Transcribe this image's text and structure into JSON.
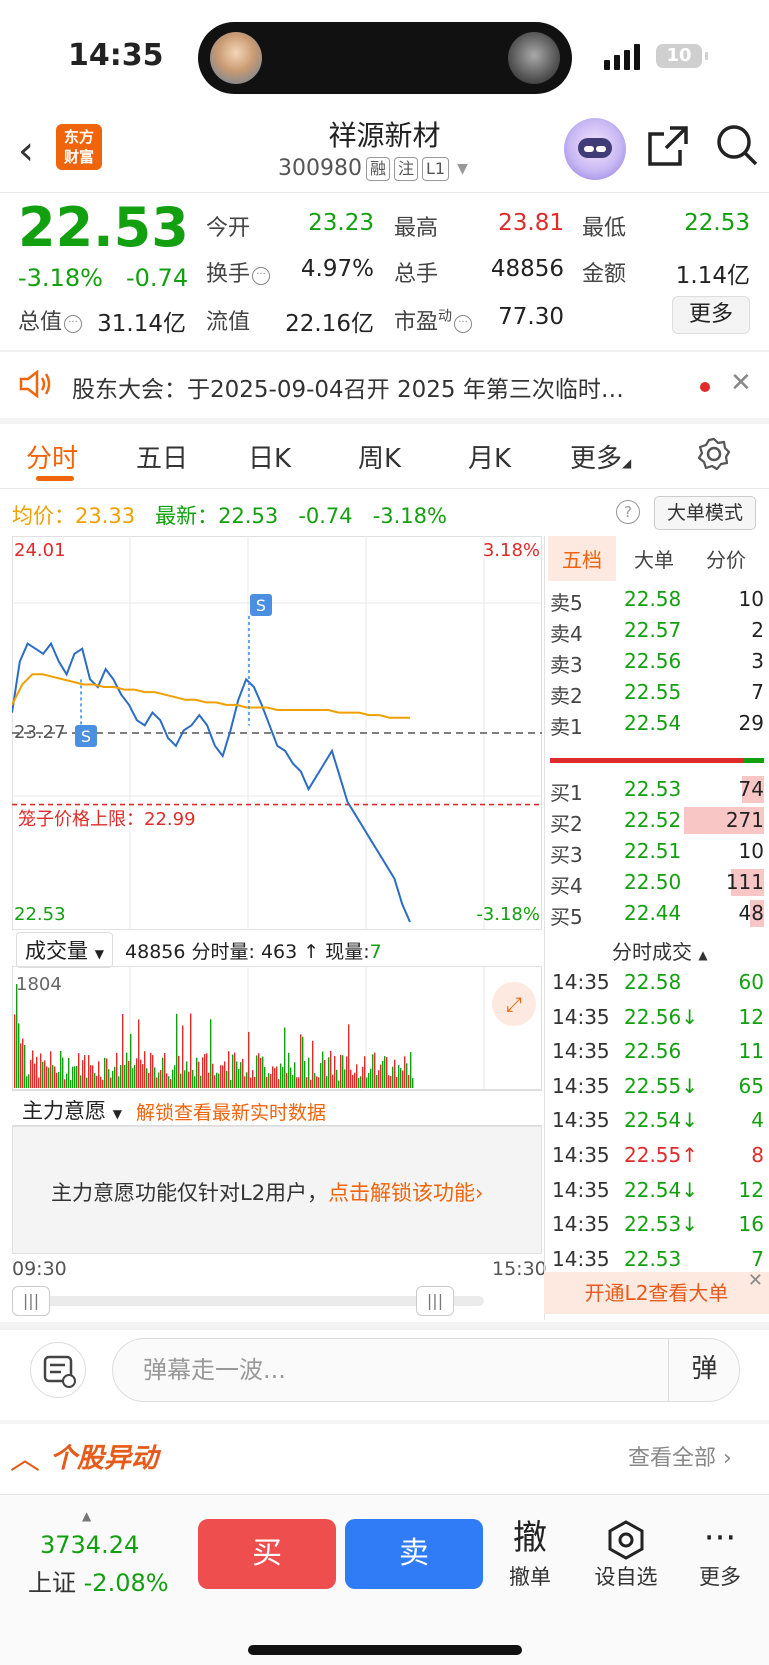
{
  "status": {
    "time": "14:35",
    "battery": "10"
  },
  "header": {
    "logo": "东方\n财富",
    "title": "祥源新材",
    "code": "300980",
    "tags": [
      "融",
      "注",
      "L1"
    ]
  },
  "quote": {
    "price": "22.53",
    "change_pct": "-3.18%",
    "change": "-0.74",
    "fields": {
      "open_label": "今开",
      "open": "23.23",
      "high_label": "最高",
      "high": "23.81",
      "low_label": "最低",
      "low": "22.53",
      "turnover_label": "换手",
      "turnover": "4.97%",
      "vol_label": "总手",
      "vol": "48856",
      "amount_label": "金额",
      "amount": "1.14亿",
      "mktcap_label": "总值",
      "mktcap": "31.14亿",
      "float_label": "流值",
      "float": "22.16亿",
      "pe_label": "市盈",
      "pe_sup": "动",
      "pe": "77.30"
    },
    "more": "更多"
  },
  "notice": {
    "text": "股东大会：于2025-09-04召开 2025 年第三次临时…"
  },
  "tabs": [
    "分时",
    "五日",
    "日K",
    "周K",
    "月K",
    "更多"
  ],
  "chart_head": {
    "avg_label": "均价：",
    "avg": "23.33",
    "latest_label": "最新：",
    "latest": "22.53",
    "latest_chg": "-0.74",
    "latest_pct": "-3.18%",
    "mode_btn": "大单模式",
    "help": "?"
  },
  "chart_labels": {
    "top_price": "24.01",
    "top_pct": "3.18%",
    "mid_price": "23.27",
    "cage_label": "笼子价格上限：22.99",
    "bottom_price": "22.53",
    "bottom_pct": "-3.18%",
    "marker": "S",
    "time_start": "09:30",
    "time_end": "15:30"
  },
  "chart_data": {
    "type": "line",
    "x_range": [
      "09:30",
      "15:00"
    ],
    "ylim": [
      22.53,
      24.01
    ],
    "prev_close": 23.27,
    "cage_upper": 22.99,
    "series": [
      {
        "values": [
          23.35,
          23.55,
          23.62,
          23.6,
          23.58,
          23.62,
          23.55,
          23.5,
          23.58,
          23.6,
          23.48,
          23.45,
          23.52,
          23.48,
          23.42,
          23.38,
          23.32,
          23.3,
          23.35,
          23.32,
          23.25,
          23.22,
          23.28,
          23.3,
          23.34,
          23.3,
          23.22,
          23.18,
          23.28,
          23.4,
          23.48,
          23.45,
          23.38,
          23.3,
          23.22,
          23.2,
          23.15,
          23.12,
          23.05,
          23.1,
          23.15,
          23.2,
          23.1,
          23.0,
          22.95,
          22.9,
          22.85,
          22.8,
          22.75,
          22.7,
          22.6,
          22.53
        ]
      },
      {
        "values": [
          23.38,
          23.46,
          23.5,
          23.5,
          23.49,
          23.48,
          23.47,
          23.46,
          23.46,
          23.45,
          23.45,
          23.44,
          23.44,
          23.43,
          23.43,
          23.42,
          23.41,
          23.4,
          23.4,
          23.39,
          23.39,
          23.38,
          23.38,
          23.37,
          23.37,
          23.37,
          23.36,
          23.36,
          23.36,
          23.36,
          23.36,
          23.36,
          23.35,
          23.35,
          23.35,
          23.34,
          23.34,
          23.33,
          23.33,
          23.33
        ]
      }
    ],
    "volume_max": "1804"
  },
  "vol_head": {
    "dropdown": "成交量",
    "vol": "48856",
    "fs_label": "分时量:",
    "fs": "463",
    "arrow": "↑",
    "cur_label": "现量:",
    "cur": "7"
  },
  "mainforce": {
    "dropdown": "主力意愿",
    "unlock": "解锁查看最新实时数据",
    "text": "主力意愿功能仅针对L2用户，",
    "link": "点击解锁该功能›"
  },
  "orderbook": {
    "tabs": [
      "五档",
      "大单",
      "分价"
    ],
    "asks": [
      {
        "label": "卖5",
        "price": "22.58",
        "vol": "10"
      },
      {
        "label": "卖4",
        "price": "22.57",
        "vol": "2"
      },
      {
        "label": "卖3",
        "price": "22.56",
        "vol": "3"
      },
      {
        "label": "卖2",
        "price": "22.55",
        "vol": "7"
      },
      {
        "label": "卖1",
        "price": "22.54",
        "vol": "29"
      }
    ],
    "bids": [
      {
        "label": "买1",
        "price": "22.53",
        "vol": "74"
      },
      {
        "label": "买2",
        "price": "22.52",
        "vol": "271"
      },
      {
        "label": "买3",
        "price": "22.51",
        "vol": "10"
      },
      {
        "label": "买4",
        "price": "22.50",
        "vol": "111"
      },
      {
        "label": "买5",
        "price": "22.44",
        "vol": "48"
      }
    ]
  },
  "deals": {
    "title": "分时成交",
    "rows": [
      {
        "t": "14:35",
        "p": "22.58",
        "v": "60",
        "c": "green"
      },
      {
        "t": "14:35",
        "p": "22.56↓",
        "v": "12",
        "c": "green"
      },
      {
        "t": "14:35",
        "p": "22.56",
        "v": "11",
        "c": "green"
      },
      {
        "t": "14:35",
        "p": "22.55↓",
        "v": "65",
        "c": "green"
      },
      {
        "t": "14:35",
        "p": "22.54↓",
        "v": "4",
        "c": "green"
      },
      {
        "t": "14:35",
        "p": "22.55↑",
        "v": "8",
        "c": "red"
      },
      {
        "t": "14:35",
        "p": "22.54↓",
        "v": "12",
        "c": "green"
      },
      {
        "t": "14:35",
        "p": "22.53↓",
        "v": "16",
        "c": "green"
      },
      {
        "t": "14:35",
        "p": "22.53",
        "v": "7",
        "c": "green"
      }
    ],
    "banner": "开通L2查看大单"
  },
  "comment": {
    "placeholder": "弹幕走一波...",
    "danmu": "弹"
  },
  "movers": {
    "title": "个股异动",
    "all": "查看全部 ›"
  },
  "bottom": {
    "index_val": "3734.24",
    "index_name": "上证",
    "index_chg": "-2.08%",
    "buy": "买",
    "sell": "卖",
    "cancel_icon": "撤",
    "cancel": "撤单",
    "watch": "设自选",
    "more": "更多"
  }
}
